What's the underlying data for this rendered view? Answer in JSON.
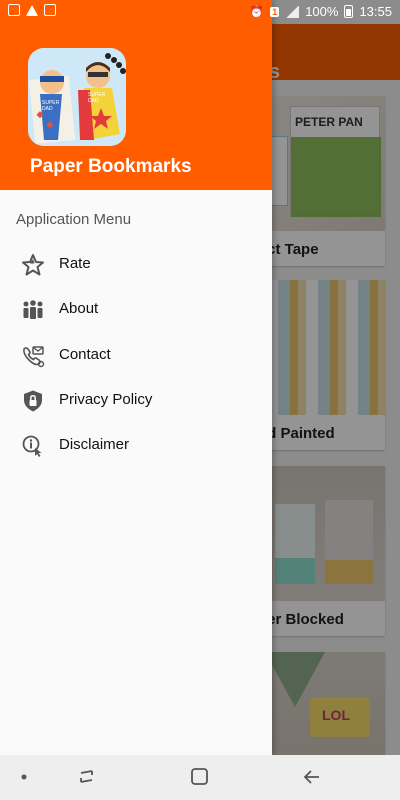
{
  "status_bar": {
    "battery": "100%",
    "time": "13:55",
    "sim_badge": "1"
  },
  "background_screen": {
    "title_fragment": "rks",
    "cards": [
      {
        "title_fragment": "uct Tape",
        "image_text": "PETER PAN"
      },
      {
        "title_fragment": "nd Painted"
      },
      {
        "title_fragment": "ner Blocked"
      },
      {
        "title_fragment": "",
        "image_text": "LOL"
      }
    ]
  },
  "drawer": {
    "app_name": "Paper Bookmarks",
    "logo_labels": [
      "SUPER DAD",
      "SUPER DAD"
    ],
    "section_title": "Application Menu",
    "items": [
      {
        "label": "Rate",
        "icon": "star-icon"
      },
      {
        "label": "About",
        "icon": "people-icon"
      },
      {
        "label": "Contact",
        "icon": "contact-icon"
      },
      {
        "label": "Privacy Policy",
        "icon": "shield-lock-icon"
      },
      {
        "label": "Disclaimer",
        "icon": "info-touch-icon"
      }
    ]
  },
  "nav_bar": {
    "buttons": [
      "dot",
      "recents",
      "home",
      "back"
    ]
  },
  "colors": {
    "primary": "#ff5d00",
    "drawer_bg": "#fafafa",
    "icon": "#555555"
  }
}
